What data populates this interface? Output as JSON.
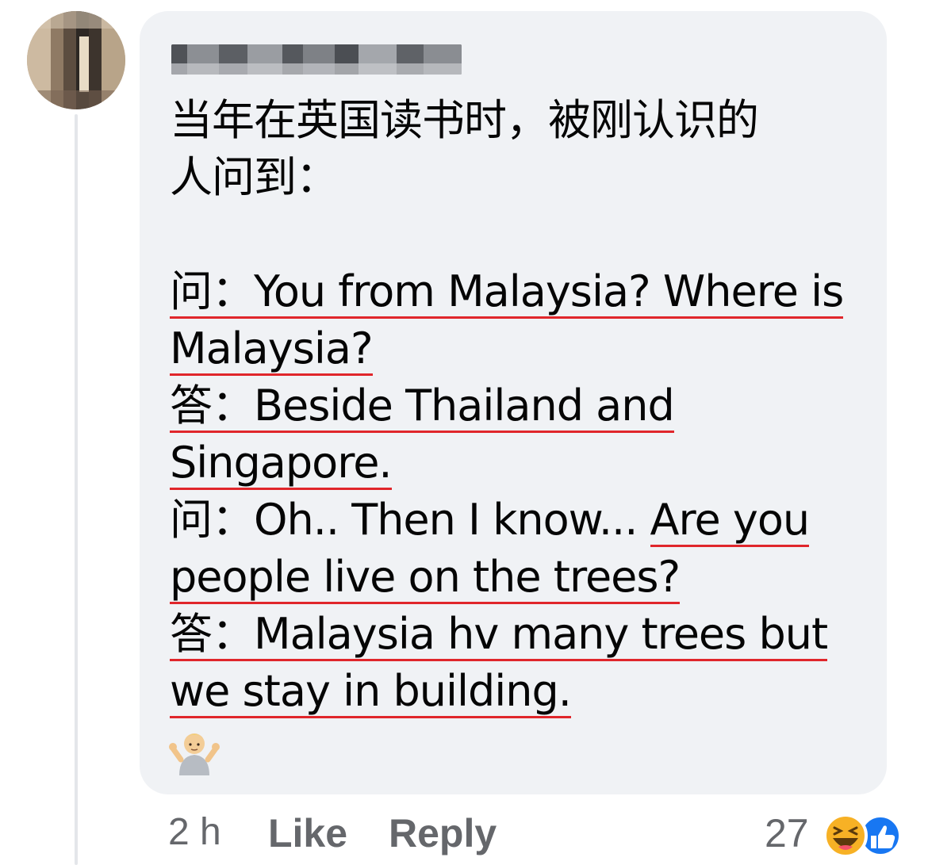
{
  "comment": {
    "author_name": "",
    "lines": [
      {
        "text": "当年在英国读书时，被刚认识的",
        "underline": false
      },
      {
        "text": "人问到：",
        "underline": false
      },
      {
        "text": "",
        "underline": false
      },
      {
        "text": "问：You from Malaysia? Where is",
        "underline": true
      },
      {
        "text": "Malaysia?",
        "underline": true
      },
      {
        "text": "答：Beside Thailand and",
        "underline": true
      },
      {
        "text": "Singapore.",
        "underline": true
      },
      {
        "text_plain": "问：Oh.. Then I know... ",
        "text_under": "Are you",
        "underline": "partial"
      },
      {
        "text": "people live on the trees?",
        "underline": true
      },
      {
        "text": "答：Malaysia hv many trees but",
        "underline": true
      },
      {
        "text": "we stay in building.",
        "underline": true
      }
    ],
    "emoji": "person-shrugging-emoji"
  },
  "footer": {
    "time": "2 h",
    "like_label": "Like",
    "reply_label": "Reply",
    "reaction_count": "27",
    "reaction_icons": [
      "haha-icon",
      "like-thumb-icon"
    ]
  },
  "colors": {
    "bubble_bg": "#f0f2f5",
    "underline_red": "#e0262b",
    "meta_gray": "#65676b",
    "like_blue": "#1877f2",
    "haha_yellow": "#f7b125"
  }
}
